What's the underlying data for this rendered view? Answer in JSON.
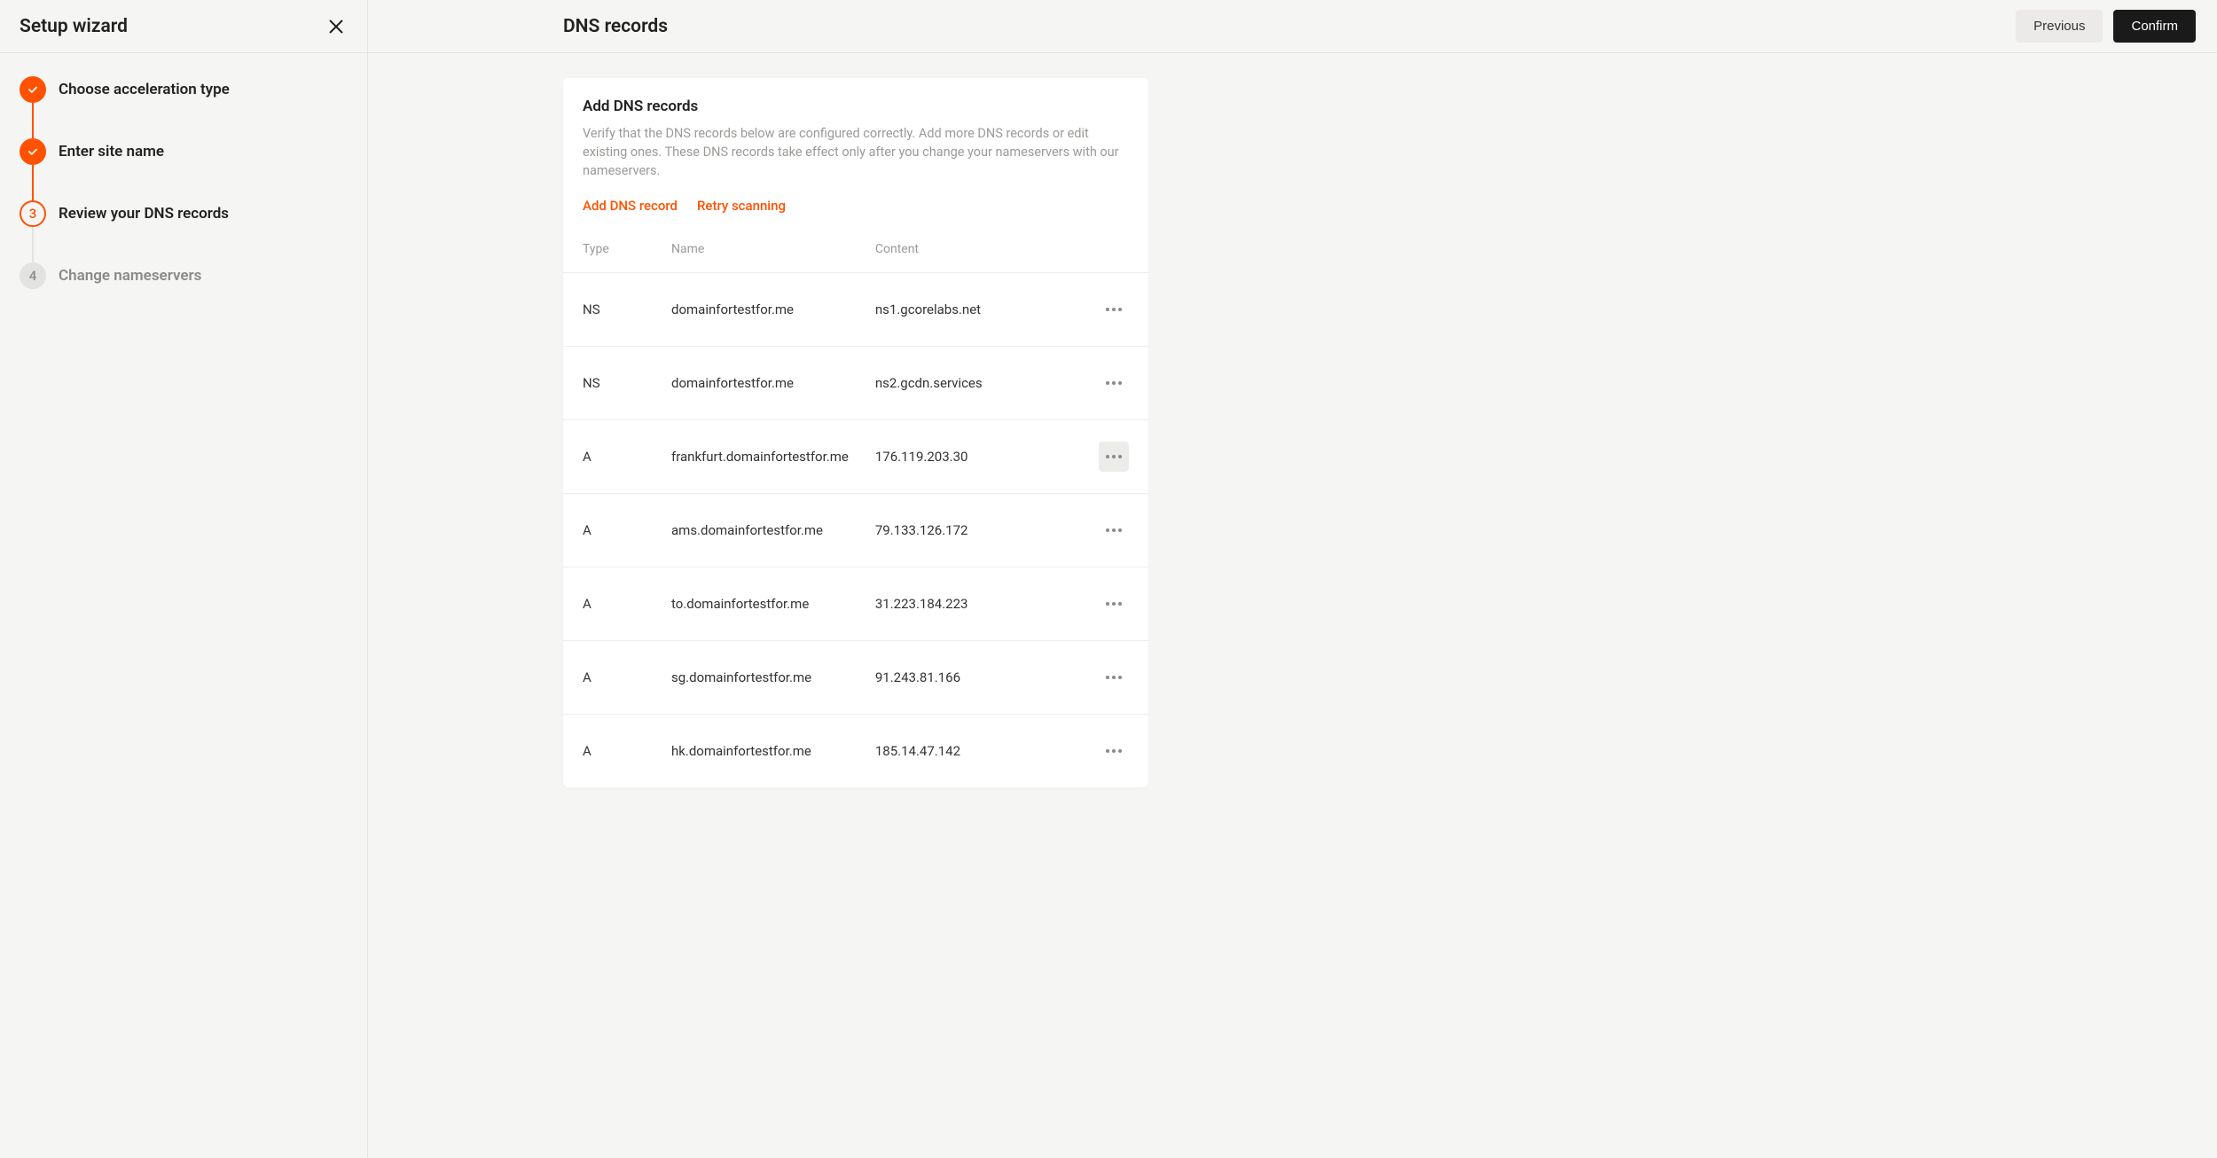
{
  "sidebar": {
    "title": "Setup wizard",
    "steps": [
      {
        "label": "Choose acceleration type",
        "state": "done"
      },
      {
        "label": "Enter site name",
        "state": "done"
      },
      {
        "label": "Review your DNS records",
        "state": "current",
        "number": "3"
      },
      {
        "label": "Change nameservers",
        "state": "pending",
        "number": "4"
      }
    ]
  },
  "header": {
    "title": "DNS records",
    "buttons": {
      "previous": "Previous",
      "confirm": "Confirm"
    }
  },
  "card": {
    "title": "Add DNS records",
    "description": "Verify that the DNS records below are configured correctly. Add more DNS records or edit existing ones. These DNS records take effect only after you change your nameservers with our nameservers.",
    "add_link": "Add DNS record",
    "retry_link": "Retry scanning"
  },
  "table": {
    "columns": {
      "type": "Type",
      "name": "Name",
      "content": "Content"
    },
    "rows": [
      {
        "type": "NS",
        "name": "domainfortestfor.me",
        "content": "ns1.gcorelabs.net",
        "menu_active": false
      },
      {
        "type": "NS",
        "name": "domainfortestfor.me",
        "content": "ns2.gcdn.services",
        "menu_active": false
      },
      {
        "type": "A",
        "name": "frankfurt.domainfortestfor.me",
        "content": "176.119.203.30",
        "menu_active": true
      },
      {
        "type": "A",
        "name": "ams.domainfortestfor.me",
        "content": "79.133.126.172",
        "menu_active": false
      },
      {
        "type": "A",
        "name": "to.domainfortestfor.me",
        "content": "31.223.184.223",
        "menu_active": false
      },
      {
        "type": "A",
        "name": "sg.domainfortestfor.me",
        "content": "91.243.81.166",
        "menu_active": false
      },
      {
        "type": "A",
        "name": "hk.domainfortestfor.me",
        "content": "185.14.47.142",
        "menu_active": false
      }
    ]
  },
  "colors": {
    "accent": "#ff5100",
    "bg": "#f5f5f4",
    "text_muted": "#9a9a97",
    "btn_dark": "#1a1a1a"
  }
}
